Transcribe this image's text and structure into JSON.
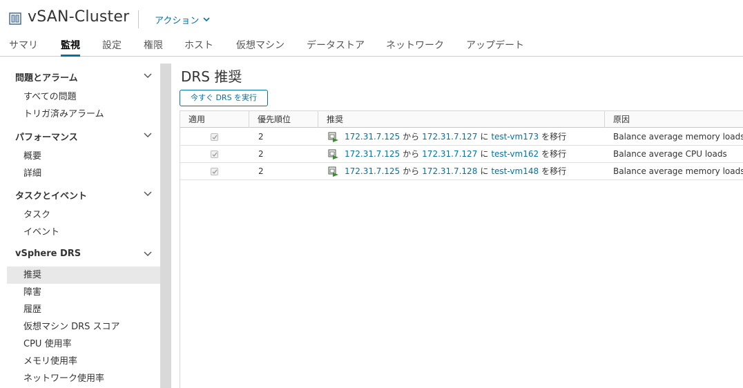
{
  "header": {
    "title": "vSAN-Cluster",
    "actions_label": "アクション"
  },
  "tabs": [
    {
      "label": "サマリ",
      "active": false
    },
    {
      "label": "監視",
      "active": true
    },
    {
      "label": "設定",
      "active": false
    },
    {
      "label": "権限",
      "active": false
    },
    {
      "label": "ホスト",
      "active": false
    },
    {
      "label": "仮想マシン",
      "active": false
    },
    {
      "label": "データストア",
      "active": false
    },
    {
      "label": "ネットワーク",
      "active": false
    },
    {
      "label": "アップデート",
      "active": false
    }
  ],
  "sidebar": {
    "groups": [
      {
        "label": "問題とアラーム",
        "items": [
          {
            "label": "すべての問題"
          },
          {
            "label": "トリガ済みアラーム"
          }
        ]
      },
      {
        "label": "パフォーマンス",
        "items": [
          {
            "label": "概要"
          },
          {
            "label": "詳細"
          }
        ]
      },
      {
        "label": "タスクとイベント",
        "items": [
          {
            "label": "タスク"
          },
          {
            "label": "イベント"
          }
        ]
      },
      {
        "label": "vSphere DRS",
        "items": [
          {
            "label": "推奨",
            "selected": true
          },
          {
            "label": "障害"
          },
          {
            "label": "履歴"
          },
          {
            "label": "仮想マシン DRS スコア"
          },
          {
            "label": "CPU 使用率"
          },
          {
            "label": "メモリ使用率"
          },
          {
            "label": "ネットワーク使用率"
          }
        ]
      }
    ]
  },
  "main": {
    "title": "DRS 推奨",
    "run_button": "今すぐ DRS を実行",
    "columns": [
      "適用",
      "優先順位",
      "推奨",
      "原因"
    ],
    "rows": [
      {
        "applied": true,
        "priority": "2",
        "from": "172.31.7.125",
        "kara": "から",
        "to": "172.31.7.127",
        "ni": "に",
        "vm": "test-vm173",
        "action": "を移行",
        "reason": "Balance average memory loads"
      },
      {
        "applied": true,
        "priority": "2",
        "from": "172.31.7.125",
        "kara": "から",
        "to": "172.31.7.127",
        "ni": "に",
        "vm": "test-vm162",
        "action": "を移行",
        "reason": "Balance average CPU loads"
      },
      {
        "applied": true,
        "priority": "2",
        "from": "172.31.7.125",
        "kara": "から",
        "to": "172.31.7.128",
        "ni": "に",
        "vm": "test-vm148",
        "action": "を移行",
        "reason": "Balance average memory loads"
      }
    ]
  },
  "colors": {
    "accent": "#0072a3",
    "migrate_green": "#3c8d2f"
  },
  "icons": {
    "cluster": "cluster-icon",
    "actions_chevron": "chevron-down-icon",
    "group_chevron": "chevron-down-icon",
    "migrate": "migrate-vm-icon",
    "checkbox": "checkbox-checked-icon"
  }
}
